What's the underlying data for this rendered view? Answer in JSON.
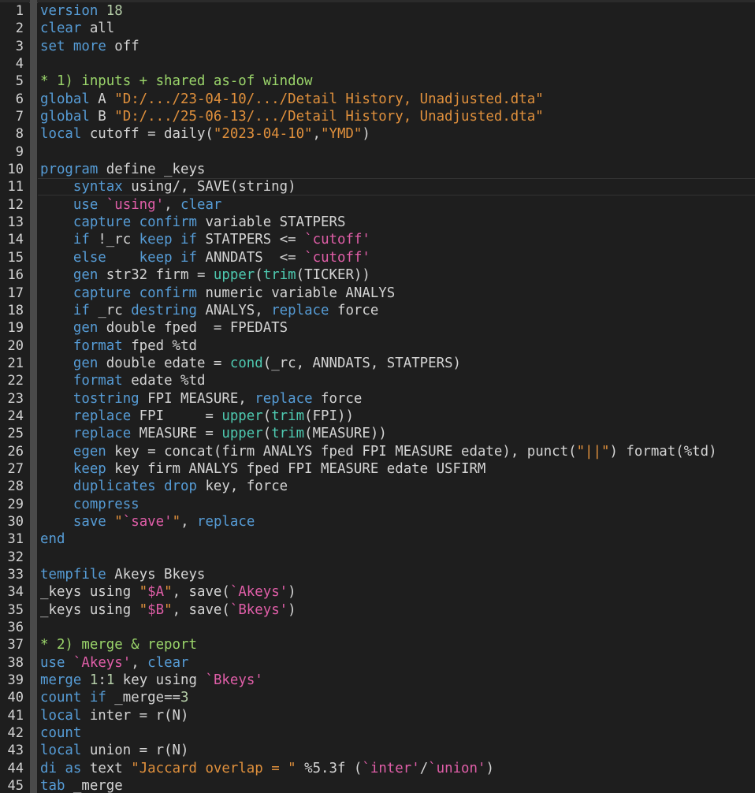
{
  "lines": [
    {
      "n": "1",
      "tokens": [
        [
          "k",
          "version"
        ],
        [
          "t",
          " "
        ],
        [
          "n",
          "18"
        ]
      ]
    },
    {
      "n": "2",
      "tokens": [
        [
          "k",
          "clear"
        ],
        [
          "t",
          " all"
        ]
      ]
    },
    {
      "n": "3",
      "tokens": [
        [
          "k",
          "set"
        ],
        [
          "t",
          " "
        ],
        [
          "k",
          "more"
        ],
        [
          "t",
          " off"
        ]
      ]
    },
    {
      "n": "4",
      "tokens": []
    },
    {
      "n": "5",
      "tokens": [
        [
          "cg",
          "* 1) inputs + shared as-of window"
        ]
      ]
    },
    {
      "n": "6",
      "tokens": [
        [
          "k",
          "global"
        ],
        [
          "t",
          " A "
        ],
        [
          "s2",
          "\"D:/.../23-04-10/.../Detail History, Unadjusted.dta\""
        ]
      ]
    },
    {
      "n": "7",
      "tokens": [
        [
          "k",
          "global"
        ],
        [
          "t",
          " B "
        ],
        [
          "s2",
          "\"D:/.../25-06-13/.../Detail History, Unadjusted.dta\""
        ]
      ]
    },
    {
      "n": "8",
      "tokens": [
        [
          "k",
          "local"
        ],
        [
          "t",
          " cutoff = daily("
        ],
        [
          "s2",
          "\"2023-04-10\""
        ],
        [
          "t",
          ","
        ],
        [
          "s2",
          "\"YMD\""
        ],
        [
          "t",
          ")"
        ]
      ]
    },
    {
      "n": "9",
      "tokens": []
    },
    {
      "n": "10",
      "tokens": [
        [
          "k",
          "program"
        ],
        [
          "t",
          " define _keys"
        ]
      ]
    },
    {
      "n": "11",
      "tokens": [
        [
          "t",
          "    "
        ],
        [
          "k",
          "syntax"
        ],
        [
          "t",
          " using/, SAVE(string)"
        ]
      ]
    },
    {
      "n": "12",
      "tokens": [
        [
          "t",
          "    "
        ],
        [
          "k",
          "use"
        ],
        [
          "t",
          " "
        ],
        [
          "m",
          "`using'"
        ],
        [
          "t",
          ", "
        ],
        [
          "k",
          "clear"
        ]
      ]
    },
    {
      "n": "13",
      "tokens": [
        [
          "t",
          "    "
        ],
        [
          "k",
          "capture"
        ],
        [
          "t",
          " "
        ],
        [
          "k",
          "confirm"
        ],
        [
          "t",
          " variable STATPERS"
        ]
      ]
    },
    {
      "n": "14",
      "tokens": [
        [
          "t",
          "    "
        ],
        [
          "k",
          "if"
        ],
        [
          "t",
          " !_rc "
        ],
        [
          "k",
          "keep"
        ],
        [
          "t",
          " "
        ],
        [
          "k",
          "if"
        ],
        [
          "t",
          " STATPERS <= "
        ],
        [
          "m",
          "`cutoff'"
        ]
      ]
    },
    {
      "n": "15",
      "tokens": [
        [
          "t",
          "    "
        ],
        [
          "k",
          "else"
        ],
        [
          "t",
          "    "
        ],
        [
          "k",
          "keep"
        ],
        [
          "t",
          " "
        ],
        [
          "k",
          "if"
        ],
        [
          "t",
          " ANNDATS  <= "
        ],
        [
          "m",
          "`cutoff'"
        ]
      ]
    },
    {
      "n": "16",
      "tokens": [
        [
          "t",
          "    "
        ],
        [
          "k",
          "gen"
        ],
        [
          "t",
          " str32 firm = "
        ],
        [
          "f",
          "upper"
        ],
        [
          "t",
          "("
        ],
        [
          "f",
          "trim"
        ],
        [
          "t",
          "(TICKER))"
        ]
      ]
    },
    {
      "n": "17",
      "tokens": [
        [
          "t",
          "    "
        ],
        [
          "k",
          "capture"
        ],
        [
          "t",
          " "
        ],
        [
          "k",
          "confirm"
        ],
        [
          "t",
          " numeric variable ANALYS"
        ]
      ]
    },
    {
      "n": "18",
      "tokens": [
        [
          "t",
          "    "
        ],
        [
          "k",
          "if"
        ],
        [
          "t",
          " _rc "
        ],
        [
          "k",
          "destring"
        ],
        [
          "t",
          " ANALYS, "
        ],
        [
          "k",
          "replace"
        ],
        [
          "t",
          " force"
        ]
      ]
    },
    {
      "n": "19",
      "tokens": [
        [
          "t",
          "    "
        ],
        [
          "k",
          "gen"
        ],
        [
          "t",
          " double fped  = FPEDATS"
        ]
      ]
    },
    {
      "n": "20",
      "tokens": [
        [
          "t",
          "    "
        ],
        [
          "k",
          "format"
        ],
        [
          "t",
          " fped %td"
        ]
      ]
    },
    {
      "n": "21",
      "tokens": [
        [
          "t",
          "    "
        ],
        [
          "k",
          "gen"
        ],
        [
          "t",
          " double edate = "
        ],
        [
          "f",
          "cond"
        ],
        [
          "t",
          "(_rc, ANNDATS, STATPERS)"
        ]
      ]
    },
    {
      "n": "22",
      "tokens": [
        [
          "t",
          "    "
        ],
        [
          "k",
          "format"
        ],
        [
          "t",
          " edate %td"
        ]
      ]
    },
    {
      "n": "23",
      "tokens": [
        [
          "t",
          "    "
        ],
        [
          "k",
          "tostring"
        ],
        [
          "t",
          " FPI MEASURE, "
        ],
        [
          "k",
          "replace"
        ],
        [
          "t",
          " force"
        ]
      ]
    },
    {
      "n": "24",
      "tokens": [
        [
          "t",
          "    "
        ],
        [
          "k",
          "replace"
        ],
        [
          "t",
          " FPI     = "
        ],
        [
          "f",
          "upper"
        ],
        [
          "t",
          "("
        ],
        [
          "f",
          "trim"
        ],
        [
          "t",
          "(FPI))"
        ]
      ]
    },
    {
      "n": "25",
      "tokens": [
        [
          "t",
          "    "
        ],
        [
          "k",
          "replace"
        ],
        [
          "t",
          " MEASURE = "
        ],
        [
          "f",
          "upper"
        ],
        [
          "t",
          "("
        ],
        [
          "f",
          "trim"
        ],
        [
          "t",
          "(MEASURE))"
        ]
      ]
    },
    {
      "n": "26",
      "tokens": [
        [
          "t",
          "    "
        ],
        [
          "k",
          "egen"
        ],
        [
          "t",
          " key = concat(firm ANALYS fped FPI MEASURE edate), punct("
        ],
        [
          "s2",
          "\"||\""
        ],
        [
          "t",
          ") format(%td)"
        ]
      ]
    },
    {
      "n": "27",
      "tokens": [
        [
          "t",
          "    "
        ],
        [
          "k",
          "keep"
        ],
        [
          "t",
          " key firm ANALYS fped FPI MEASURE edate USFIRM"
        ]
      ]
    },
    {
      "n": "28",
      "tokens": [
        [
          "t",
          "    "
        ],
        [
          "k",
          "duplicates"
        ],
        [
          "t",
          " "
        ],
        [
          "k",
          "drop"
        ],
        [
          "t",
          " key, force"
        ]
      ]
    },
    {
      "n": "29",
      "tokens": [
        [
          "t",
          "    "
        ],
        [
          "k",
          "compress"
        ]
      ]
    },
    {
      "n": "30",
      "tokens": [
        [
          "t",
          "    "
        ],
        [
          "k",
          "save"
        ],
        [
          "t",
          " "
        ],
        [
          "s2",
          "\""
        ],
        [
          "m",
          "`save'"
        ],
        [
          "s2",
          "\""
        ],
        [
          "t",
          ", "
        ],
        [
          "k",
          "replace"
        ]
      ]
    },
    {
      "n": "31",
      "tokens": [
        [
          "k",
          "end"
        ]
      ]
    },
    {
      "n": "32",
      "tokens": []
    },
    {
      "n": "33",
      "tokens": [
        [
          "k",
          "tempfile"
        ],
        [
          "t",
          " Akeys Bkeys"
        ]
      ]
    },
    {
      "n": "34",
      "tokens": [
        [
          "t",
          "_keys using "
        ],
        [
          "s2",
          "\""
        ],
        [
          "m",
          "$A"
        ],
        [
          "s2",
          "\""
        ],
        [
          "t",
          ", save("
        ],
        [
          "m",
          "`Akeys'"
        ],
        [
          "t",
          ")"
        ]
      ]
    },
    {
      "n": "35",
      "tokens": [
        [
          "t",
          "_keys using "
        ],
        [
          "s2",
          "\""
        ],
        [
          "m",
          "$B"
        ],
        [
          "s2",
          "\""
        ],
        [
          "t",
          ", save("
        ],
        [
          "m",
          "`Bkeys'"
        ],
        [
          "t",
          ")"
        ]
      ]
    },
    {
      "n": "36",
      "tokens": []
    },
    {
      "n": "37",
      "tokens": [
        [
          "cg",
          "* 2) merge & report"
        ]
      ]
    },
    {
      "n": "38",
      "tokens": [
        [
          "k",
          "use"
        ],
        [
          "t",
          " "
        ],
        [
          "m",
          "`Akeys'"
        ],
        [
          "t",
          ", "
        ],
        [
          "k",
          "clear"
        ]
      ]
    },
    {
      "n": "39",
      "tokens": [
        [
          "k",
          "merge"
        ],
        [
          "t",
          " "
        ],
        [
          "n",
          "1"
        ],
        [
          "t",
          ":"
        ],
        [
          "n",
          "1"
        ],
        [
          "t",
          " key using "
        ],
        [
          "m",
          "`Bkeys'"
        ]
      ]
    },
    {
      "n": "40",
      "tokens": [
        [
          "k",
          "count"
        ],
        [
          "t",
          " "
        ],
        [
          "k",
          "if"
        ],
        [
          "t",
          " _merge=="
        ],
        [
          "n",
          "3"
        ]
      ]
    },
    {
      "n": "41",
      "tokens": [
        [
          "k",
          "local"
        ],
        [
          "t",
          " inter = r(N)"
        ]
      ]
    },
    {
      "n": "42",
      "tokens": [
        [
          "k",
          "count"
        ]
      ]
    },
    {
      "n": "43",
      "tokens": [
        [
          "k",
          "local"
        ],
        [
          "t",
          " union = r(N)"
        ]
      ]
    },
    {
      "n": "44",
      "tokens": [
        [
          "k",
          "di"
        ],
        [
          "t",
          " "
        ],
        [
          "k",
          "as"
        ],
        [
          "t",
          " text "
        ],
        [
          "s2",
          "\"Jaccard overlap = \""
        ],
        [
          "t",
          " %5.3f ("
        ],
        [
          "m",
          "`inter'"
        ],
        [
          "t",
          "/"
        ],
        [
          "m",
          "`union'"
        ],
        [
          "t",
          ")"
        ]
      ]
    },
    {
      "n": "45",
      "tokens": [
        [
          "k",
          "tab"
        ],
        [
          "t",
          " _merge"
        ]
      ]
    }
  ]
}
